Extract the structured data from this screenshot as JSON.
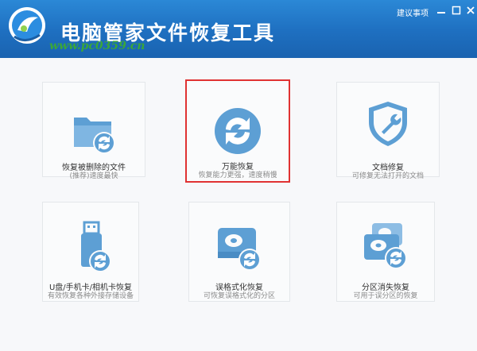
{
  "window": {
    "title": "电脑管家文件恢复工具",
    "watermark": "www.pc0359.cn",
    "suggest_label": "建议事项"
  },
  "colors": {
    "titlebar": "#1e6fc0",
    "icon_blue": "#5d9fd4",
    "selected_border": "#e03232"
  },
  "cards": [
    {
      "label": "恢复被删除的文件",
      "desc": "(推荐)速度最快",
      "icon": "folder-recover-icon"
    },
    {
      "label": "万能恢复",
      "desc": "恢复能力更强，速度稍慢",
      "icon": "universal-recover-icon",
      "selected": true
    },
    {
      "label": "文档修复",
      "desc": "可修复无法打开的文档",
      "icon": "shield-wrench-icon"
    },
    {
      "label": "U盘/手机卡/相机卡恢复",
      "desc": "有效恢复各种外接存储设备",
      "icon": "usb-recover-icon"
    },
    {
      "label": "误格式化恢复",
      "desc": "可恢复误格式化的分区",
      "icon": "disk-format-recover-icon"
    },
    {
      "label": "分区消失恢复",
      "desc": "可用于误分区的恢复",
      "icon": "partition-recover-icon"
    }
  ]
}
